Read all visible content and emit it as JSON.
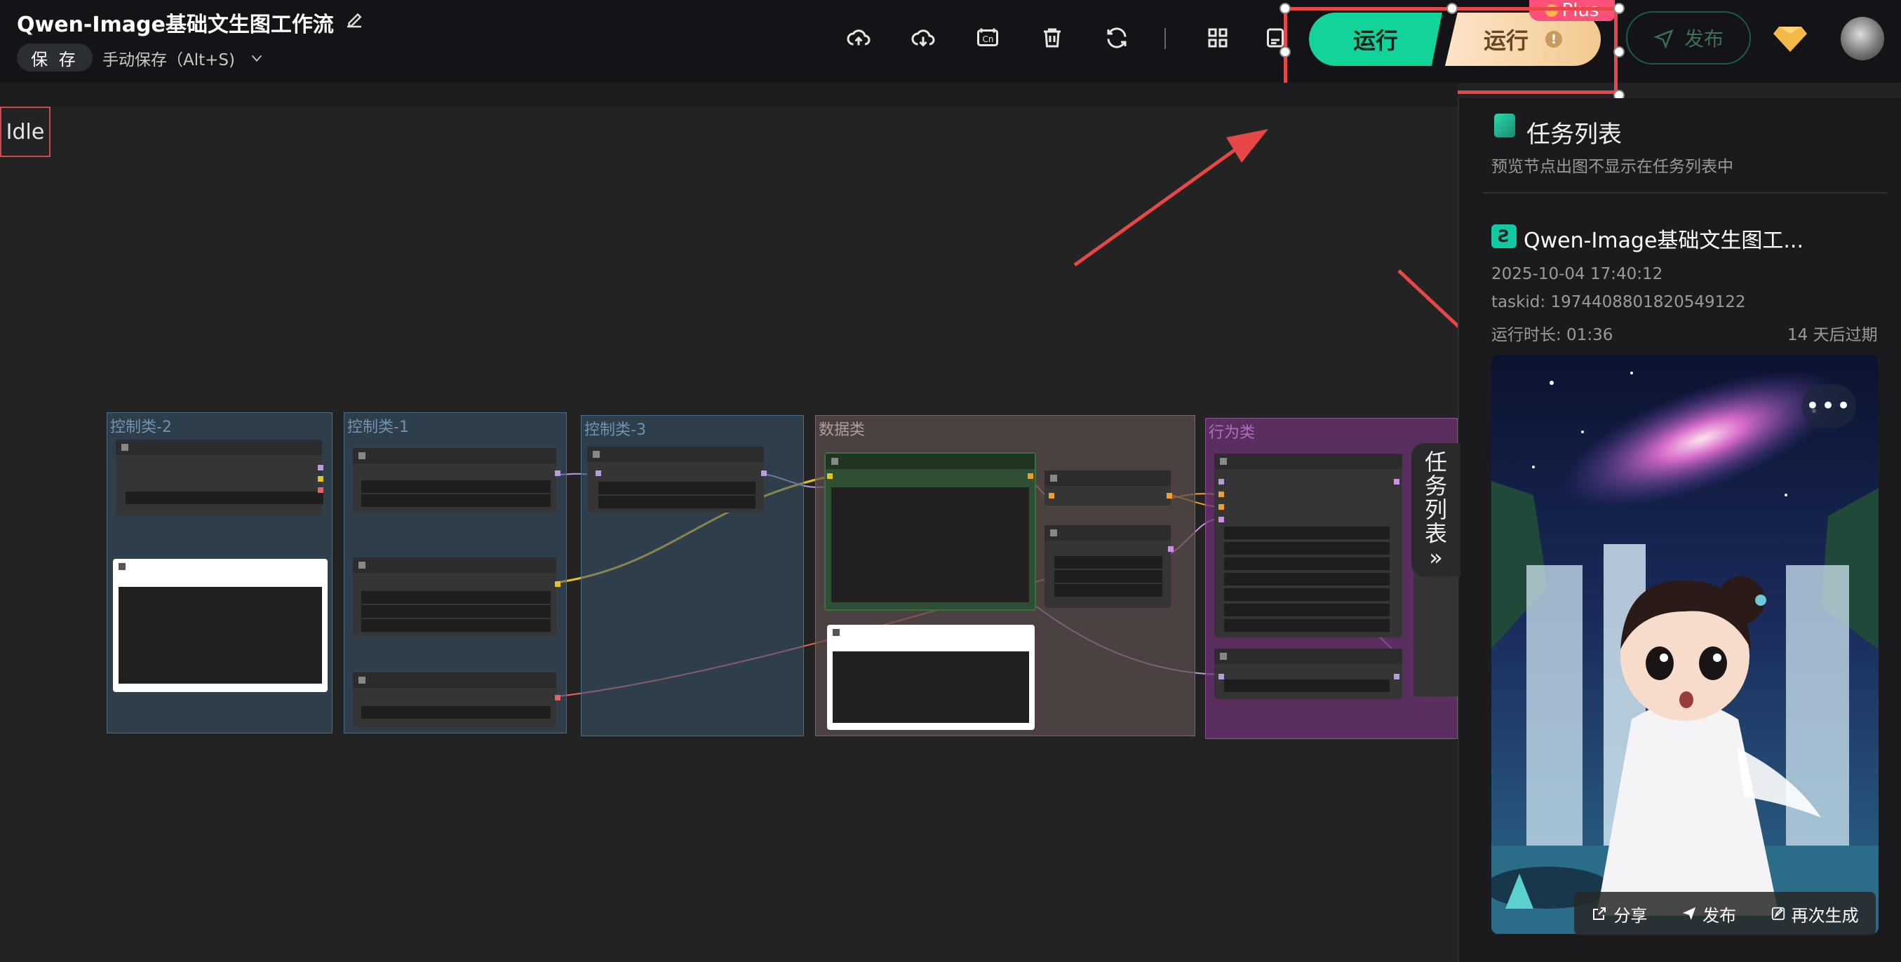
{
  "header": {
    "title": "Qwen-Image基础文生图工作流",
    "save_label": "保 存",
    "autosave_label": "手动保存（Alt+S)",
    "run_label": "运行",
    "run_plus_label": "运行",
    "plus_badge": "Plus",
    "publish_label": "发布",
    "warn_mark": "!"
  },
  "canvas": {
    "status": "Idle",
    "groups": {
      "g1": "控制类-2",
      "g2": "控制类-1",
      "g3": "控制类-3",
      "g4": "数据类",
      "g5": "行为类"
    }
  },
  "panel": {
    "title": "任务列表",
    "subtitle": "预览节点出图不显示在任务列表中",
    "tab_label": [
      "任",
      "务",
      "列",
      "表",
      "»"
    ],
    "task": {
      "name": "Qwen-Image基础文生图工...",
      "time": "2025-10-04 17:40:12",
      "taskid": "taskid: 1974408801820549122",
      "duration": "运行时长: 01:36",
      "expiry": "14 天后过期",
      "more": "•••",
      "share_label": "分享",
      "publish_label": "发布",
      "regenerate_label": "再次生成"
    }
  },
  "colors": {
    "accent_green": "#12d39a",
    "plus_gold": "#f2c98f",
    "plus_badge": "#ff4f7b",
    "annotation_red": "#e84747"
  }
}
